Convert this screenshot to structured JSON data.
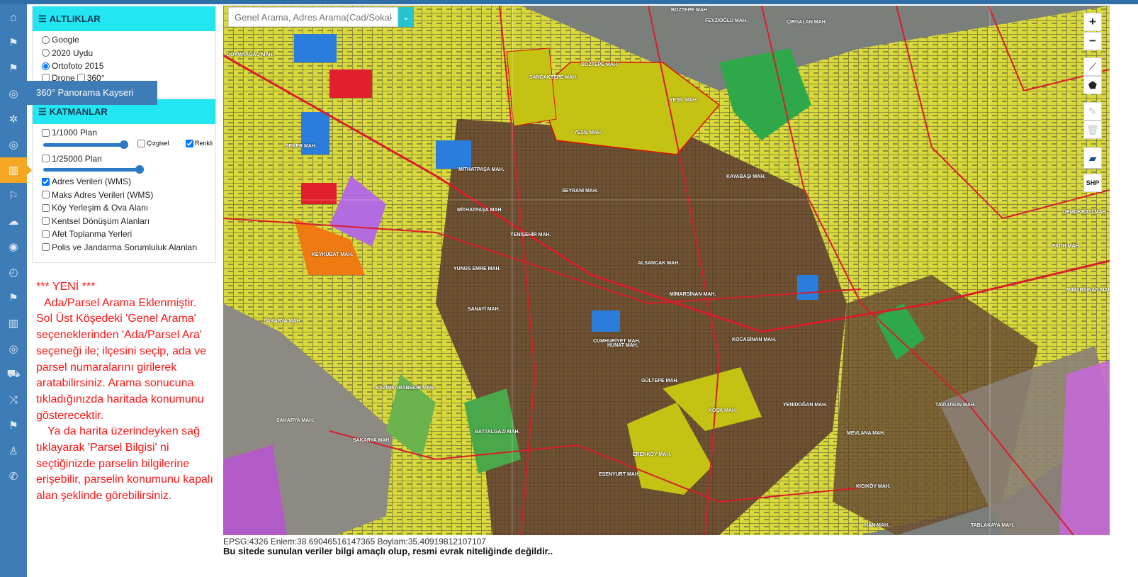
{
  "sidebar": {
    "items": [
      {
        "icon": "home-icon"
      },
      {
        "icon": "signpost-icon"
      },
      {
        "icon": "signpost-icon"
      },
      {
        "icon": "globe-icon"
      },
      {
        "icon": "aperture-icon"
      },
      {
        "icon": "globe-icon"
      },
      {
        "icon": "map-icon",
        "active": true
      },
      {
        "icon": "signs-icon"
      },
      {
        "icon": "cloud-upload-icon"
      },
      {
        "icon": "eye-icon"
      },
      {
        "icon": "history-icon"
      },
      {
        "icon": "signpost-icon"
      },
      {
        "icon": "map-icon"
      },
      {
        "icon": "globe-icon"
      },
      {
        "icon": "cart-icon"
      },
      {
        "icon": "shuffle-icon"
      },
      {
        "icon": "signpost-icon"
      },
      {
        "icon": "user-icon"
      },
      {
        "icon": "phone-icon"
      }
    ],
    "tooltip": "360° Panorama Kayseri"
  },
  "basemaps": {
    "title": "ALTLIKLAR",
    "options": [
      {
        "label": "Google",
        "checked": false
      },
      {
        "label": "2020 Uydu",
        "checked": false
      },
      {
        "label": "Ortofoto 2015",
        "checked": true
      },
      {
        "label": "Drone",
        "checked": false
      },
      {
        "label": "360°",
        "checked": false
      }
    ]
  },
  "layers": {
    "title": "KATMANLAR",
    "plan1000": {
      "label": "1/1000 Plan",
      "checked": false,
      "opacity": 0.9
    },
    "lineSub": {
      "label": "Çizgisel",
      "checked": false
    },
    "colorSub": {
      "label": "Renkli",
      "checked": true
    },
    "plan25000": {
      "label": "1/25000 Plan",
      "checked": false,
      "opacity": 1.0
    },
    "items": [
      {
        "label": "Adres Verileri (WMS)",
        "checked": true
      },
      {
        "label": "Maks Adres Verileri (WMS)",
        "checked": false
      },
      {
        "label": "Köy Yerleşim & Ova Alanı",
        "checked": false
      },
      {
        "label": "Kentsel Dönüşüm Alanları",
        "checked": false
      },
      {
        "label": "Afet Toplanma Yerleri",
        "checked": false
      },
      {
        "label": "Polis ve Jandarma Sorumluluk Alanları",
        "checked": false
      }
    ]
  },
  "notice": {
    "heading": "*** YENİ ***",
    "para1": "Ada/Parsel Arama Eklenmiştir. Sol Üst Köşedeki 'Genel Arama' seçeneklerinden 'Ada/Parsel Ara' seçeneği ile; ilçesini seçip, ada ve parsel numaralarını girilerek aratabilirsiniz. Arama sonucuna tıkladığınızda haritada konumunu gösterecektir.",
    "para2": "Ya da harita üzerindeyken sağ tıklayarak 'Parsel Bilgisi' ni seçtiğinizde parselin bilgilerine erişebilir, parselin konumunu kapalı alan şeklinde görebilirsiniz."
  },
  "search": {
    "placeholder": "Genel Arama, Adres Arama(Cad/Sokak)"
  },
  "mapControls": {
    "zoomIn": "+",
    "zoomOut": "−",
    "shp": "SHP"
  },
  "mapLabels": [
    "BOZTEPE MAH.",
    "FEVZİOĞLU MAH.",
    "ÇIRGALAN MAH.",
    "BOZTEPE MAH.",
    "SANCAKTEPE MAH.",
    "YEŞİL MAH.",
    "YEŞİL MAH.",
    "MİTHATPAŞA MAH.",
    "SEYRANI MAH.",
    "KAYABAŞI MAH.",
    "ŞEKER MAH.",
    "MİTHATPAŞA MAH.",
    "KEYKUBAT MAH.",
    "YENİŞEHİR MAH.",
    "SAKARYA MAH.",
    "SAKARYA MAH.",
    "MEVLANA MAH.",
    "YENİDOĞAN MAH.",
    "TAVLUSUN MAH.",
    "FATİH MAH.",
    "DEMOKRASİ MAH.",
    "MİMARSİNAN MAH.",
    "HAN MAH.",
    "ERENKÖY MAH.",
    "KOŞK MAH.",
    "SANAYİ MAH.",
    "ESENYURT MAH.",
    "TABLAKAYA MAH.",
    "KAZIMKARABEKİR MAH.",
    "BATTALGAZİ MAH.",
    "YUNUS EMRE MAH.",
    "MİMARSİNAN MAH.",
    "ALSANCAK MAH.",
    "CUMHURİYET MAH.",
    "HUNAT MAH.",
    "GÜLTEPE MAH.",
    "KOCASİNAN MAH.",
    "KICIKÖY MAH.",
    "SAKARYA MAH.",
    "DOYMAAĞAÇ MAH."
  ],
  "status": {
    "coords": "EPSG:4326 Enlem:38.69046516147365 Boylam:35.40919812107107",
    "disclaimer": "Bu sitede sunulan veriler bilgi amaçlı olup, resmi evrak niteliğinde değildir.."
  }
}
